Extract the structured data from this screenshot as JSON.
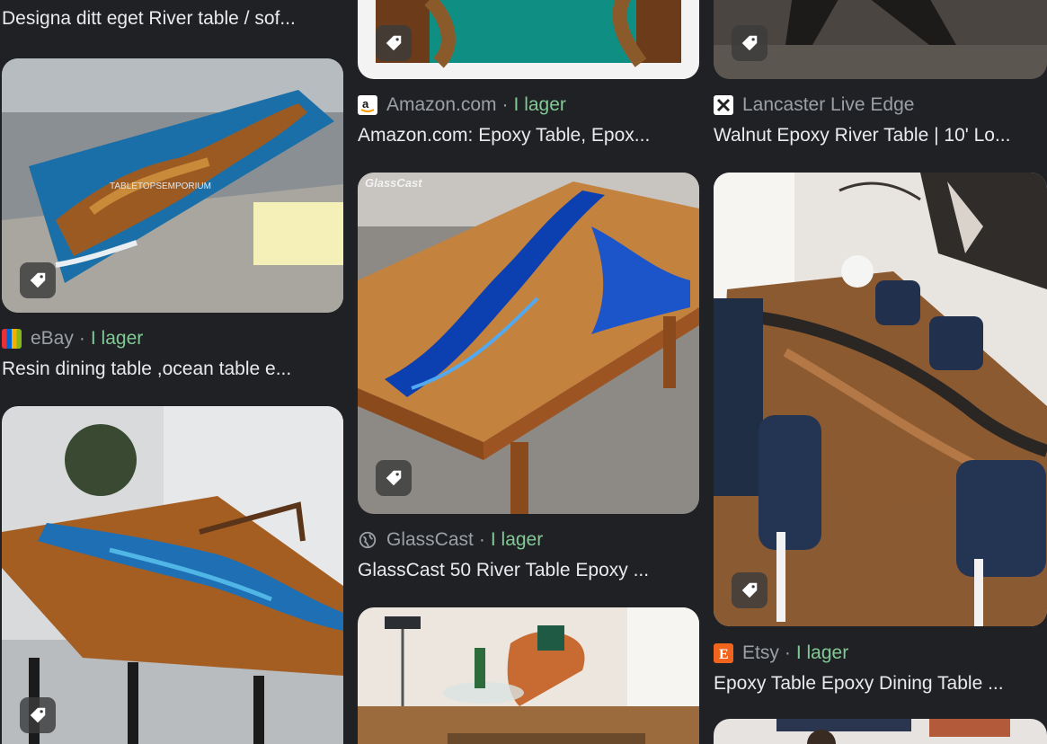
{
  "results": [
    {
      "title": "Designa ditt eget River table / sof..."
    },
    {
      "source": "eBay",
      "stock": "I lager",
      "title": "Resin dining table ,ocean table e..."
    },
    {
      "source": "Amazon.com",
      "stock": "I lager",
      "title": "Amazon.com: Epoxy Table, Epox..."
    },
    {
      "source": "GlassCast",
      "stock": "I lager",
      "title": "GlassCast 50 River Table Epoxy ...",
      "watermark": "GlassCast"
    },
    {
      "source": "Lancaster Live Edge",
      "title": "Walnut Epoxy River Table | 10' Lo..."
    },
    {
      "source": "Etsy",
      "stock": "I lager",
      "title": "Epoxy Table Epoxy Dining Table ..."
    }
  ],
  "separator": "·",
  "ebay_watermark": "TABLETOPSEMPORIUM",
  "icons": {
    "tag": "tag-icon",
    "globe": "globe-icon"
  },
  "colors": {
    "background": "#202124",
    "title": "#e8eaed",
    "source": "#9aa0a6",
    "stock": "#81c995"
  }
}
